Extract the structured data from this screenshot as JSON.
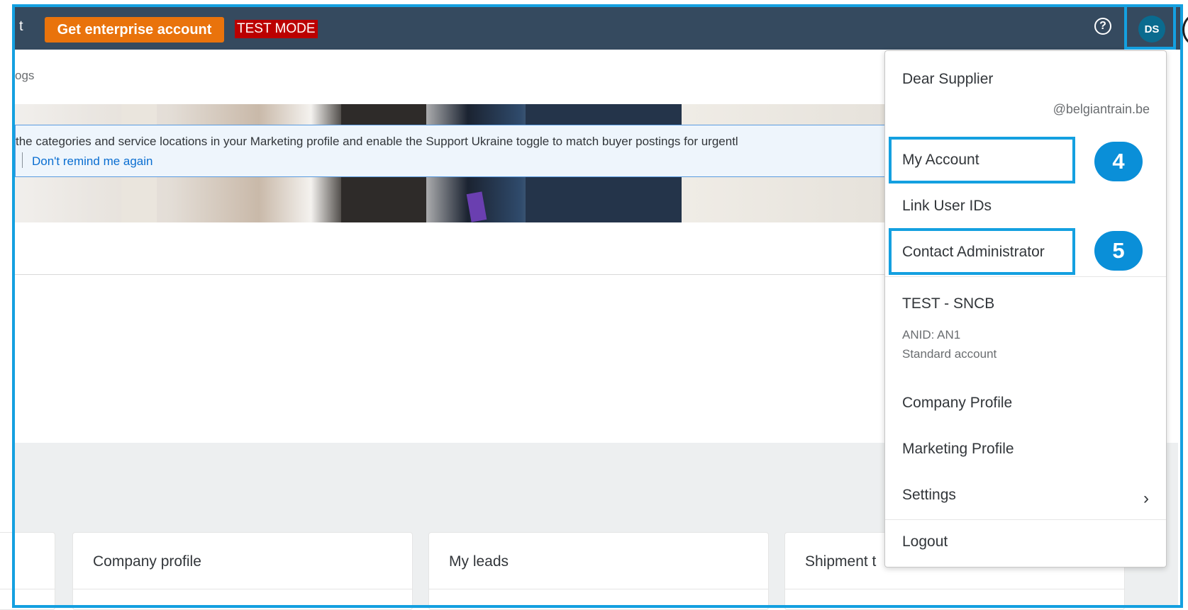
{
  "header": {
    "cut_label": "t",
    "enterprise_button": "Get enterprise account",
    "test_mode": "TEST MODE",
    "help_icon": "?",
    "avatar_initials": "DS"
  },
  "subnav": {
    "cut_label": "ogs"
  },
  "notice": {
    "text": "the categories and service locations in your Marketing profile and enable the Support Ukraine toggle to match buyer postings for urgentl",
    "dismiss_link": "Don't remind me again"
  },
  "cards": [
    {
      "title": ""
    },
    {
      "title": "Company profile"
    },
    {
      "title": "My leads"
    },
    {
      "title": "Shipment t"
    }
  ],
  "user_menu": {
    "greeting": "Dear Supplier",
    "email": "@belgiantrain.be",
    "my_account": "My Account",
    "link_user_ids": "Link User IDs",
    "contact_admin": "Contact Administrator",
    "company_name": "TEST - SNCB",
    "anid": "ANID: AN1",
    "account_type": "Standard account",
    "company_profile": "Company Profile",
    "marketing_profile": "Marketing Profile",
    "settings": "Settings",
    "settings_chevron": "›",
    "logout": "Logout"
  },
  "annotations": {
    "step_4": "4",
    "step_5": "5"
  },
  "colors": {
    "topbar": "#354a5f",
    "enterprise_button": "#e9730c",
    "test_mode_bg": "#bb0000",
    "highlight": "#14a0e0",
    "link": "#0a6ed1"
  }
}
